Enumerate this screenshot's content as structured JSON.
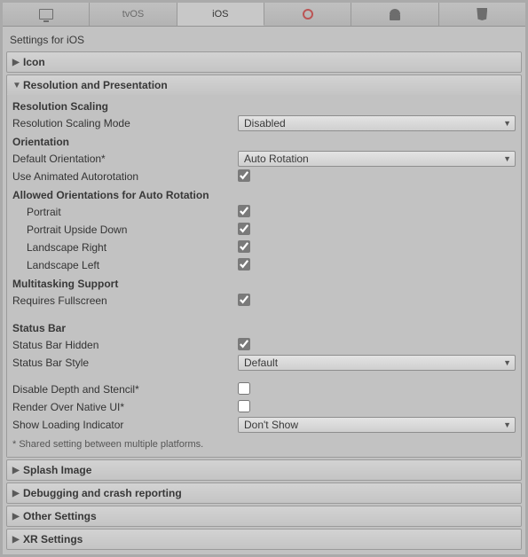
{
  "tabs": {
    "standalone": "",
    "tvos": "tvOS",
    "ios": "iOS",
    "switch": "",
    "android": "",
    "html5": ""
  },
  "page_title": "Settings for iOS",
  "sections": {
    "icon": {
      "title": "Icon"
    },
    "resolution": {
      "title": "Resolution and Presentation",
      "res_scaling_head": "Resolution Scaling",
      "res_scaling_mode_label": "Resolution Scaling Mode",
      "res_scaling_mode_value": "Disabled",
      "orientation_head": "Orientation",
      "default_orientation_label": "Default Orientation*",
      "default_orientation_value": "Auto Rotation",
      "use_animated_label": "Use Animated Autorotation",
      "use_animated_checked": true,
      "allowed_head": "Allowed Orientations for Auto Rotation",
      "portrait_label": "Portrait",
      "portrait_checked": true,
      "portrait_ud_label": "Portrait Upside Down",
      "portrait_ud_checked": true,
      "landscape_r_label": "Landscape Right",
      "landscape_r_checked": true,
      "landscape_l_label": "Landscape Left",
      "landscape_l_checked": true,
      "multitask_head": "Multitasking Support",
      "requires_fullscreen_label": "Requires Fullscreen",
      "requires_fullscreen_checked": true,
      "status_bar_head": "Status Bar",
      "status_hidden_label": "Status Bar Hidden",
      "status_hidden_checked": true,
      "status_style_label": "Status Bar Style",
      "status_style_value": "Default",
      "disable_depth_label": "Disable Depth and Stencil*",
      "disable_depth_checked": false,
      "render_native_label": "Render Over Native UI*",
      "render_native_checked": false,
      "loading_label": "Show Loading Indicator",
      "loading_value": "Don't Show",
      "footnote": "* Shared setting between multiple platforms."
    },
    "splash": {
      "title": "Splash Image"
    },
    "debug": {
      "title": "Debugging and crash reporting"
    },
    "other": {
      "title": "Other Settings"
    },
    "xr": {
      "title": "XR Settings"
    }
  }
}
